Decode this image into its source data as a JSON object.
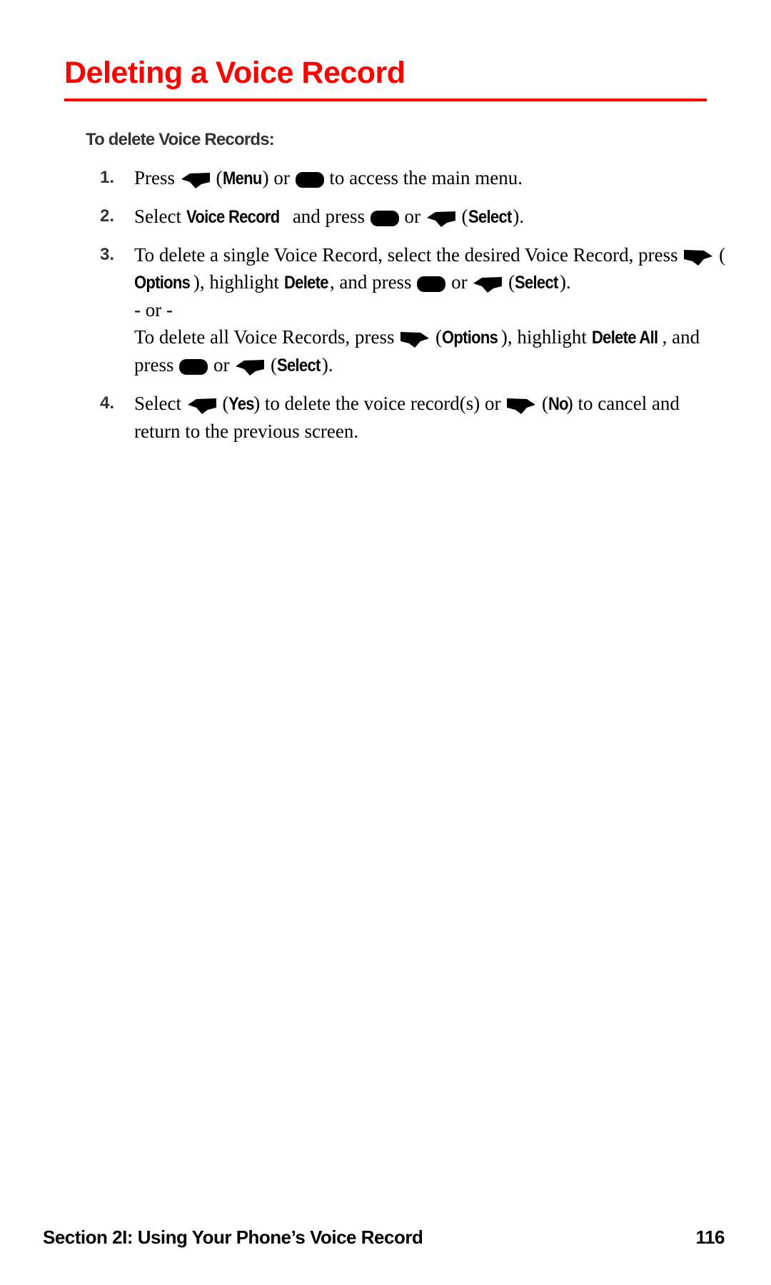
{
  "page": {
    "title": "Deleting a Voice Record",
    "accent_color": "#ff0000",
    "subheading": "To delete Voice Records:",
    "steps": [
      {
        "number": "1.",
        "parts": [
          "Press",
          "(",
          "Menu",
          ") or",
          "to access the main menu."
        ]
      },
      {
        "number": "2.",
        "parts": [
          "Select",
          "Voice Record",
          "and press",
          "or",
          "(",
          "Select",
          ")."
        ]
      },
      {
        "number": "3.",
        "parts": [
          "To delete a single Voice Record, select the desired Voice Record, press",
          "(",
          "Options",
          "), highlight",
          "Delete",
          ", and press",
          "or",
          "(",
          "Select",
          ").",
          "- or -",
          "To delete all Voice Records, press",
          "(",
          "Options",
          "), highlight",
          "Delete All",
          ", and press",
          "or",
          "(",
          "Select",
          ")."
        ]
      },
      {
        "number": "4.",
        "parts": [
          "Select",
          "(",
          "Yes",
          ") to delete the voice record(s) or",
          "(",
          "No",
          ") to cancel and return to the previous screen."
        ]
      }
    ],
    "icons": {
      "left_softkey": "left-softkey-icon",
      "right_softkey": "right-softkey-icon",
      "menu_ok": "menu-ok-key-icon"
    },
    "footer": {
      "section": "Section 2I: Using Your Phone’s Voice Record",
      "page_number": "116"
    }
  }
}
